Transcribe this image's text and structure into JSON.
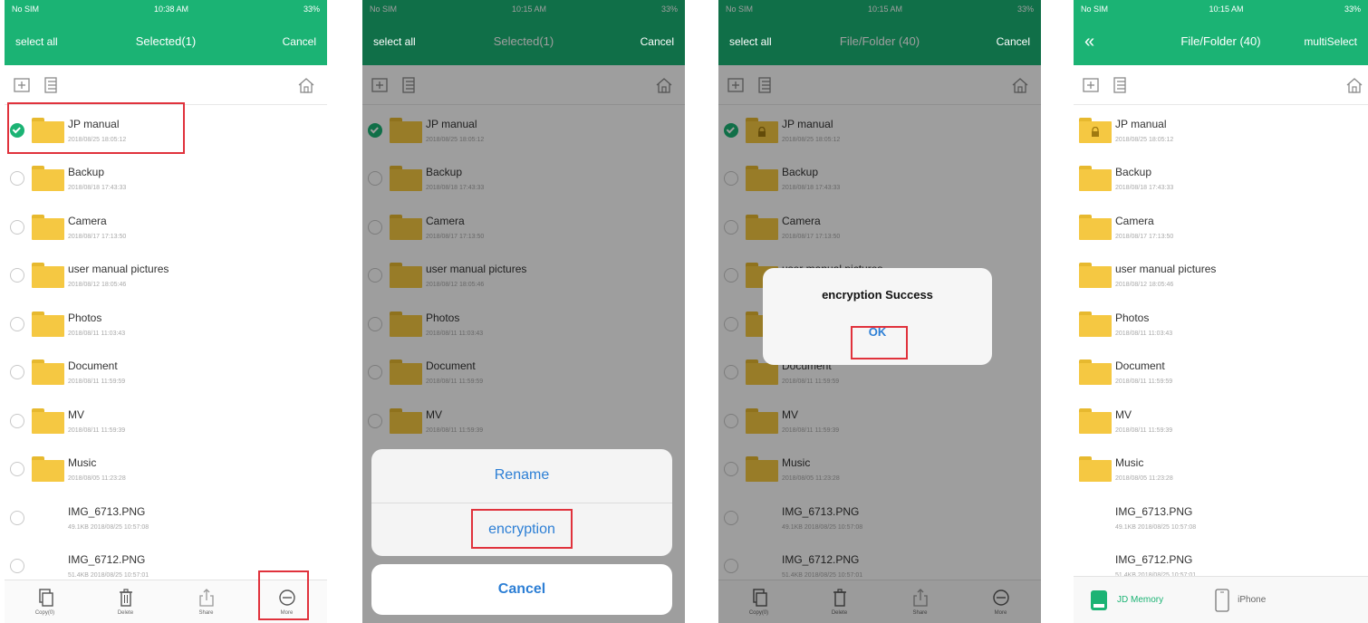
{
  "colors": {
    "accent": "#1bb374",
    "folder": "#f5c842",
    "link": "#2d7fd5",
    "highlight": "#e0323c"
  },
  "screens": [
    {
      "status": {
        "carrier": "No SIM",
        "time": "10:38 AM",
        "battery": "33%"
      },
      "nav": {
        "left": "select all",
        "title": "Selected(1)",
        "right": "Cancel"
      },
      "items": [
        {
          "name": "JP manual",
          "date": "2018/08/25 18:05:12",
          "type": "folder",
          "checked": true
        },
        {
          "name": "Backup",
          "date": "2018/08/18 17:43:33",
          "type": "folder",
          "checked": false
        },
        {
          "name": "Camera",
          "date": "2018/08/17 17:13:50",
          "type": "folder",
          "checked": false
        },
        {
          "name": "user manual pictures",
          "date": "2018/08/12 18:05:46",
          "type": "folder",
          "checked": false
        },
        {
          "name": "Photos",
          "date": "2018/08/11 11:03:43",
          "type": "folder",
          "checked": false
        },
        {
          "name": "Document",
          "date": "2018/08/11 11:59:59",
          "type": "folder",
          "checked": false
        },
        {
          "name": "MV",
          "date": "2018/08/11 11:59:39",
          "type": "folder",
          "checked": false
        },
        {
          "name": "Music",
          "date": "2018/08/05 11:23:28",
          "type": "folder",
          "checked": false
        },
        {
          "name": "IMG_6713.PNG",
          "date": "49.1KB 2018/08/25 10:57:08",
          "type": "file",
          "checked": false
        },
        {
          "name": "IMG_6712.PNG",
          "date": "51.4KB 2018/08/25 10:57:01",
          "type": "file",
          "checked": false
        }
      ],
      "bottom": [
        {
          "label": "Copy(0)"
        },
        {
          "label": "Delete"
        },
        {
          "label": "Share"
        },
        {
          "label": "More"
        }
      ]
    },
    {
      "status": {
        "carrier": "No SIM",
        "time": "10:15 AM",
        "battery": "33%"
      },
      "nav": {
        "left": "select all",
        "title": "Selected(1)",
        "right": "Cancel"
      },
      "items": [
        {
          "name": "JP manual",
          "date": "2018/08/25 18:05:12",
          "type": "folder",
          "checked": true
        },
        {
          "name": "Backup",
          "date": "2018/08/18 17:43:33",
          "type": "folder",
          "checked": false
        },
        {
          "name": "Camera",
          "date": "2018/08/17 17:13:50",
          "type": "folder",
          "checked": false
        },
        {
          "name": "user manual pictures",
          "date": "2018/08/12 18:05:46",
          "type": "folder",
          "checked": false
        },
        {
          "name": "Photos",
          "date": "2018/08/11 11:03:43",
          "type": "folder",
          "checked": false
        },
        {
          "name": "Document",
          "date": "2018/08/11 11:59:59",
          "type": "folder",
          "checked": false
        },
        {
          "name": "MV",
          "date": "2018/08/11 11:59:39",
          "type": "folder",
          "checked": false
        }
      ],
      "sheet": {
        "rename": "Rename",
        "encryption": "encryption",
        "cancel": "Cancel"
      }
    },
    {
      "status": {
        "carrier": "No SIM",
        "time": "10:15 AM",
        "battery": "33%"
      },
      "nav": {
        "left": "select all",
        "title": "File/Folder (40)",
        "right": "Cancel"
      },
      "items": [
        {
          "name": "JP manual",
          "date": "2018/08/25 18:05:12",
          "type": "folder-locked",
          "checked": true
        },
        {
          "name": "Backup",
          "date": "2018/08/18 17:43:33",
          "type": "folder",
          "checked": false
        },
        {
          "name": "Camera",
          "date": "2018/08/17 17:13:50",
          "type": "folder",
          "checked": false
        },
        {
          "name": "user manual pictures",
          "date": "2018/08/12 18:05:46",
          "type": "folder",
          "checked": false
        },
        {
          "name": "Photos",
          "date": "2018/08/11 11:03:43",
          "type": "folder",
          "checked": false
        },
        {
          "name": "Document",
          "date": "2018/08/11 11:59:59",
          "type": "folder",
          "checked": false
        },
        {
          "name": "MV",
          "date": "2018/08/11 11:59:39",
          "type": "folder",
          "checked": false
        },
        {
          "name": "Music",
          "date": "2018/08/05 11:23:28",
          "type": "folder",
          "checked": false
        },
        {
          "name": "IMG_6713.PNG",
          "date": "49.1KB 2018/08/25 10:57:08",
          "type": "file",
          "checked": false
        },
        {
          "name": "IMG_6712.PNG",
          "date": "51.4KB 2018/08/25 10:57:01",
          "type": "file",
          "checked": false
        }
      ],
      "alert": {
        "title": "encryption Success",
        "ok": "OK"
      },
      "bottom": [
        {
          "label": "Copy(0)"
        },
        {
          "label": "Delete"
        },
        {
          "label": "Share"
        },
        {
          "label": "More"
        }
      ]
    },
    {
      "status": {
        "carrier": "No SIM",
        "time": "10:15 AM",
        "battery": "33%"
      },
      "nav": {
        "left": "«",
        "title": "File/Folder (40)",
        "right": "multiSelect"
      },
      "items": [
        {
          "name": "JP manual",
          "date": "2018/08/25 18:05:12",
          "type": "folder-locked"
        },
        {
          "name": "Backup",
          "date": "2018/08/18 17:43:33",
          "type": "folder"
        },
        {
          "name": "Camera",
          "date": "2018/08/17 17:13:50",
          "type": "folder"
        },
        {
          "name": "user manual pictures",
          "date": "2018/08/12 18:05:46",
          "type": "folder"
        },
        {
          "name": "Photos",
          "date": "2018/08/11 11:03:43",
          "type": "folder"
        },
        {
          "name": "Document",
          "date": "2018/08/11 11:59:59",
          "type": "folder"
        },
        {
          "name": "MV",
          "date": "2018/08/11 11:59:39",
          "type": "folder"
        },
        {
          "name": "Music",
          "date": "2018/08/05 11:23:28",
          "type": "folder"
        },
        {
          "name": "IMG_6713.PNG",
          "date": "49.1KB 2018/08/25 10:57:08",
          "type": "file"
        },
        {
          "name": "IMG_6712.PNG",
          "date": "51.4KB 2018/08/25 10:57:01",
          "type": "file"
        }
      ],
      "tabs": [
        {
          "label": "JD Memory",
          "active": true
        },
        {
          "label": "iPhone",
          "active": false
        }
      ]
    }
  ]
}
